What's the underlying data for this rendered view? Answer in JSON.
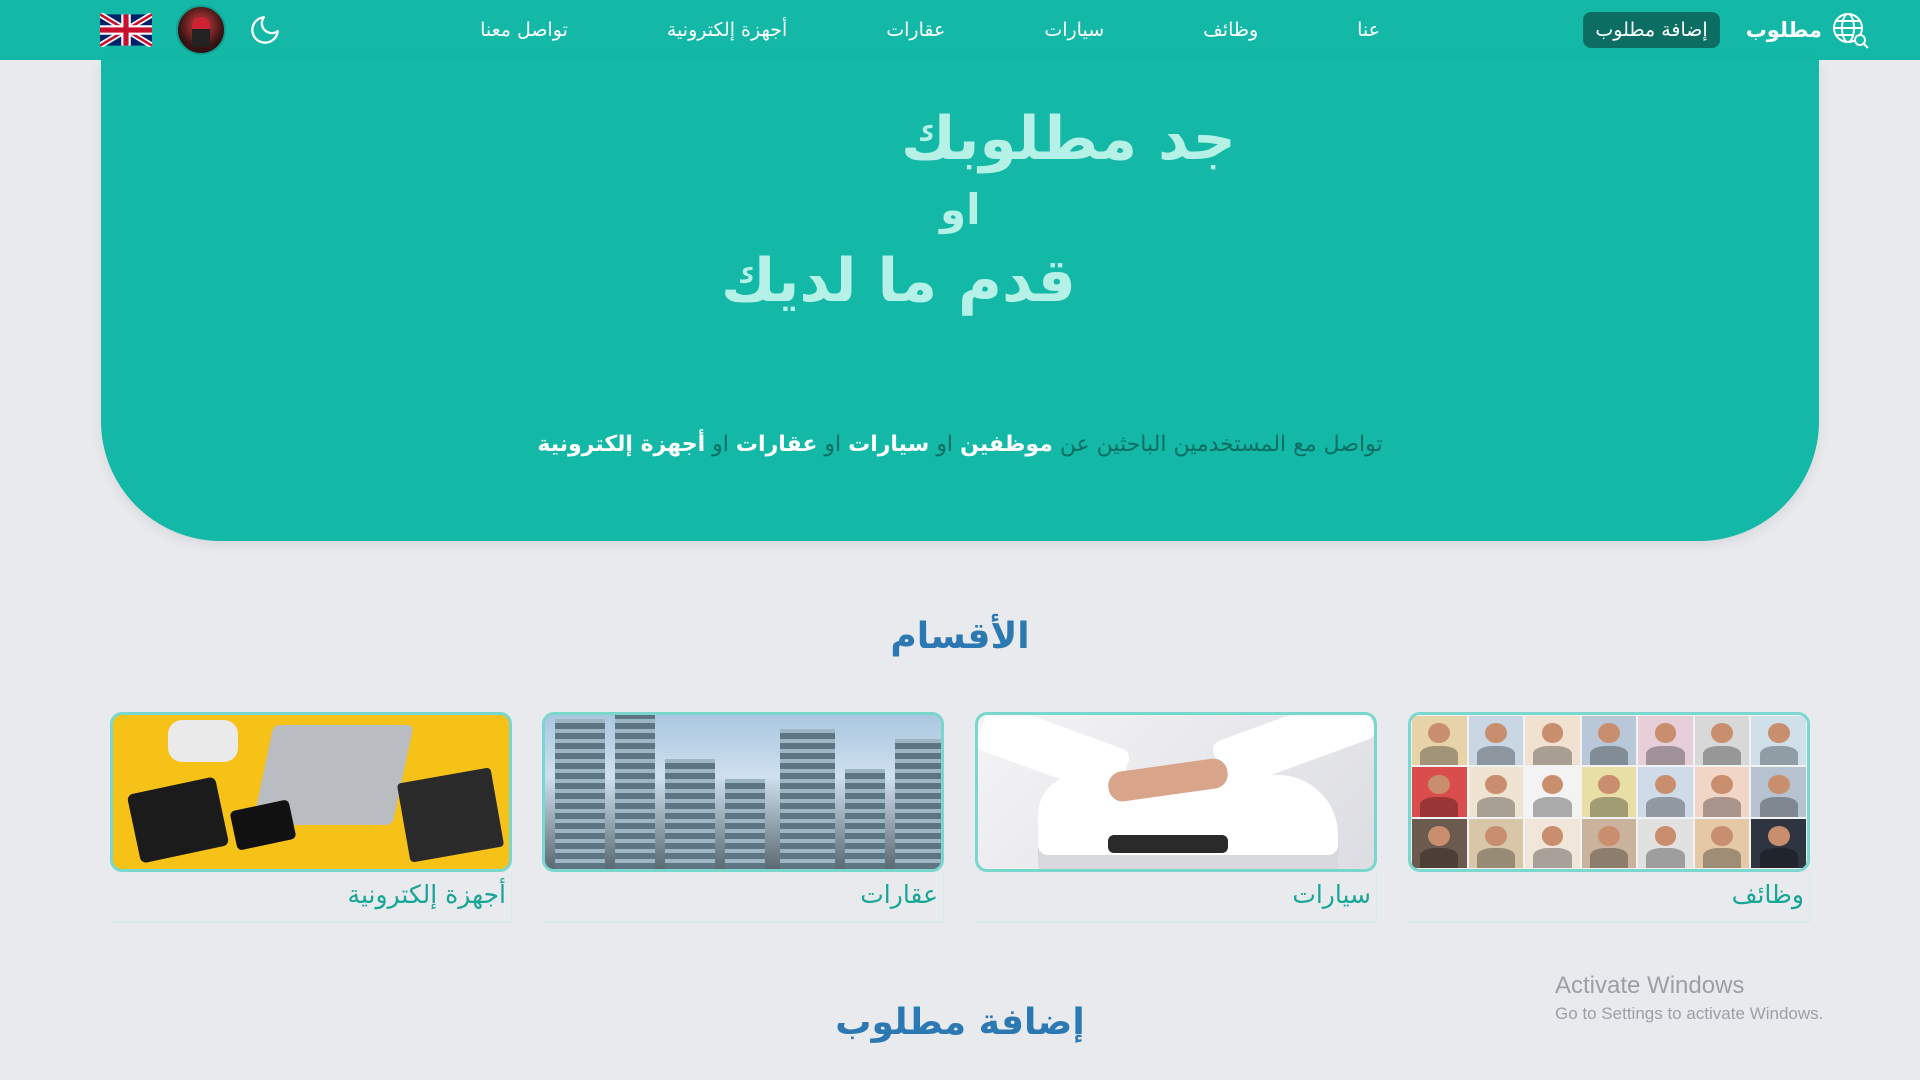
{
  "nav": {
    "brand": "مطلوب",
    "add_button": "إضافة مطلوب",
    "links": [
      "عنا",
      "وظائف",
      "سيارات",
      "عقارات",
      "أجهزة إلكترونية",
      "تواصل معنا"
    ],
    "icons": {
      "brand": "globe-search-icon",
      "theme": "moon-icon",
      "language": "uk-flag-icon",
      "profile": "avatar"
    }
  },
  "hero": {
    "title_line1": "جد مطلوبك",
    "or": "او",
    "title_line2": "قدم ما لديك",
    "subtitle": {
      "prefix": "تواصل مع المستخدمين الباحثين عن",
      "employees": "موظفين",
      "or": "او",
      "cars": "سيارات",
      "realestate": "عقارات",
      "electronics": "أجهزة إلكترونية"
    }
  },
  "sections": {
    "categories_title": "الأقسام",
    "add_title": "إضافة مطلوب"
  },
  "categories": [
    {
      "label": "وظائف"
    },
    {
      "label": "سيارات"
    },
    {
      "label": "عقارات"
    },
    {
      "label": "أجهزة إلكترونية"
    }
  ],
  "watermark": {
    "line1": "Activate Windows",
    "line2": "Go to Settings to activate Windows."
  },
  "colors": {
    "primary": "#13b8a6",
    "dark_button": "#0c6e63",
    "hero_text": "#b5f1e6",
    "section_title": "#2b78b3",
    "card_label": "#15a696",
    "background": "#e9eaee"
  }
}
